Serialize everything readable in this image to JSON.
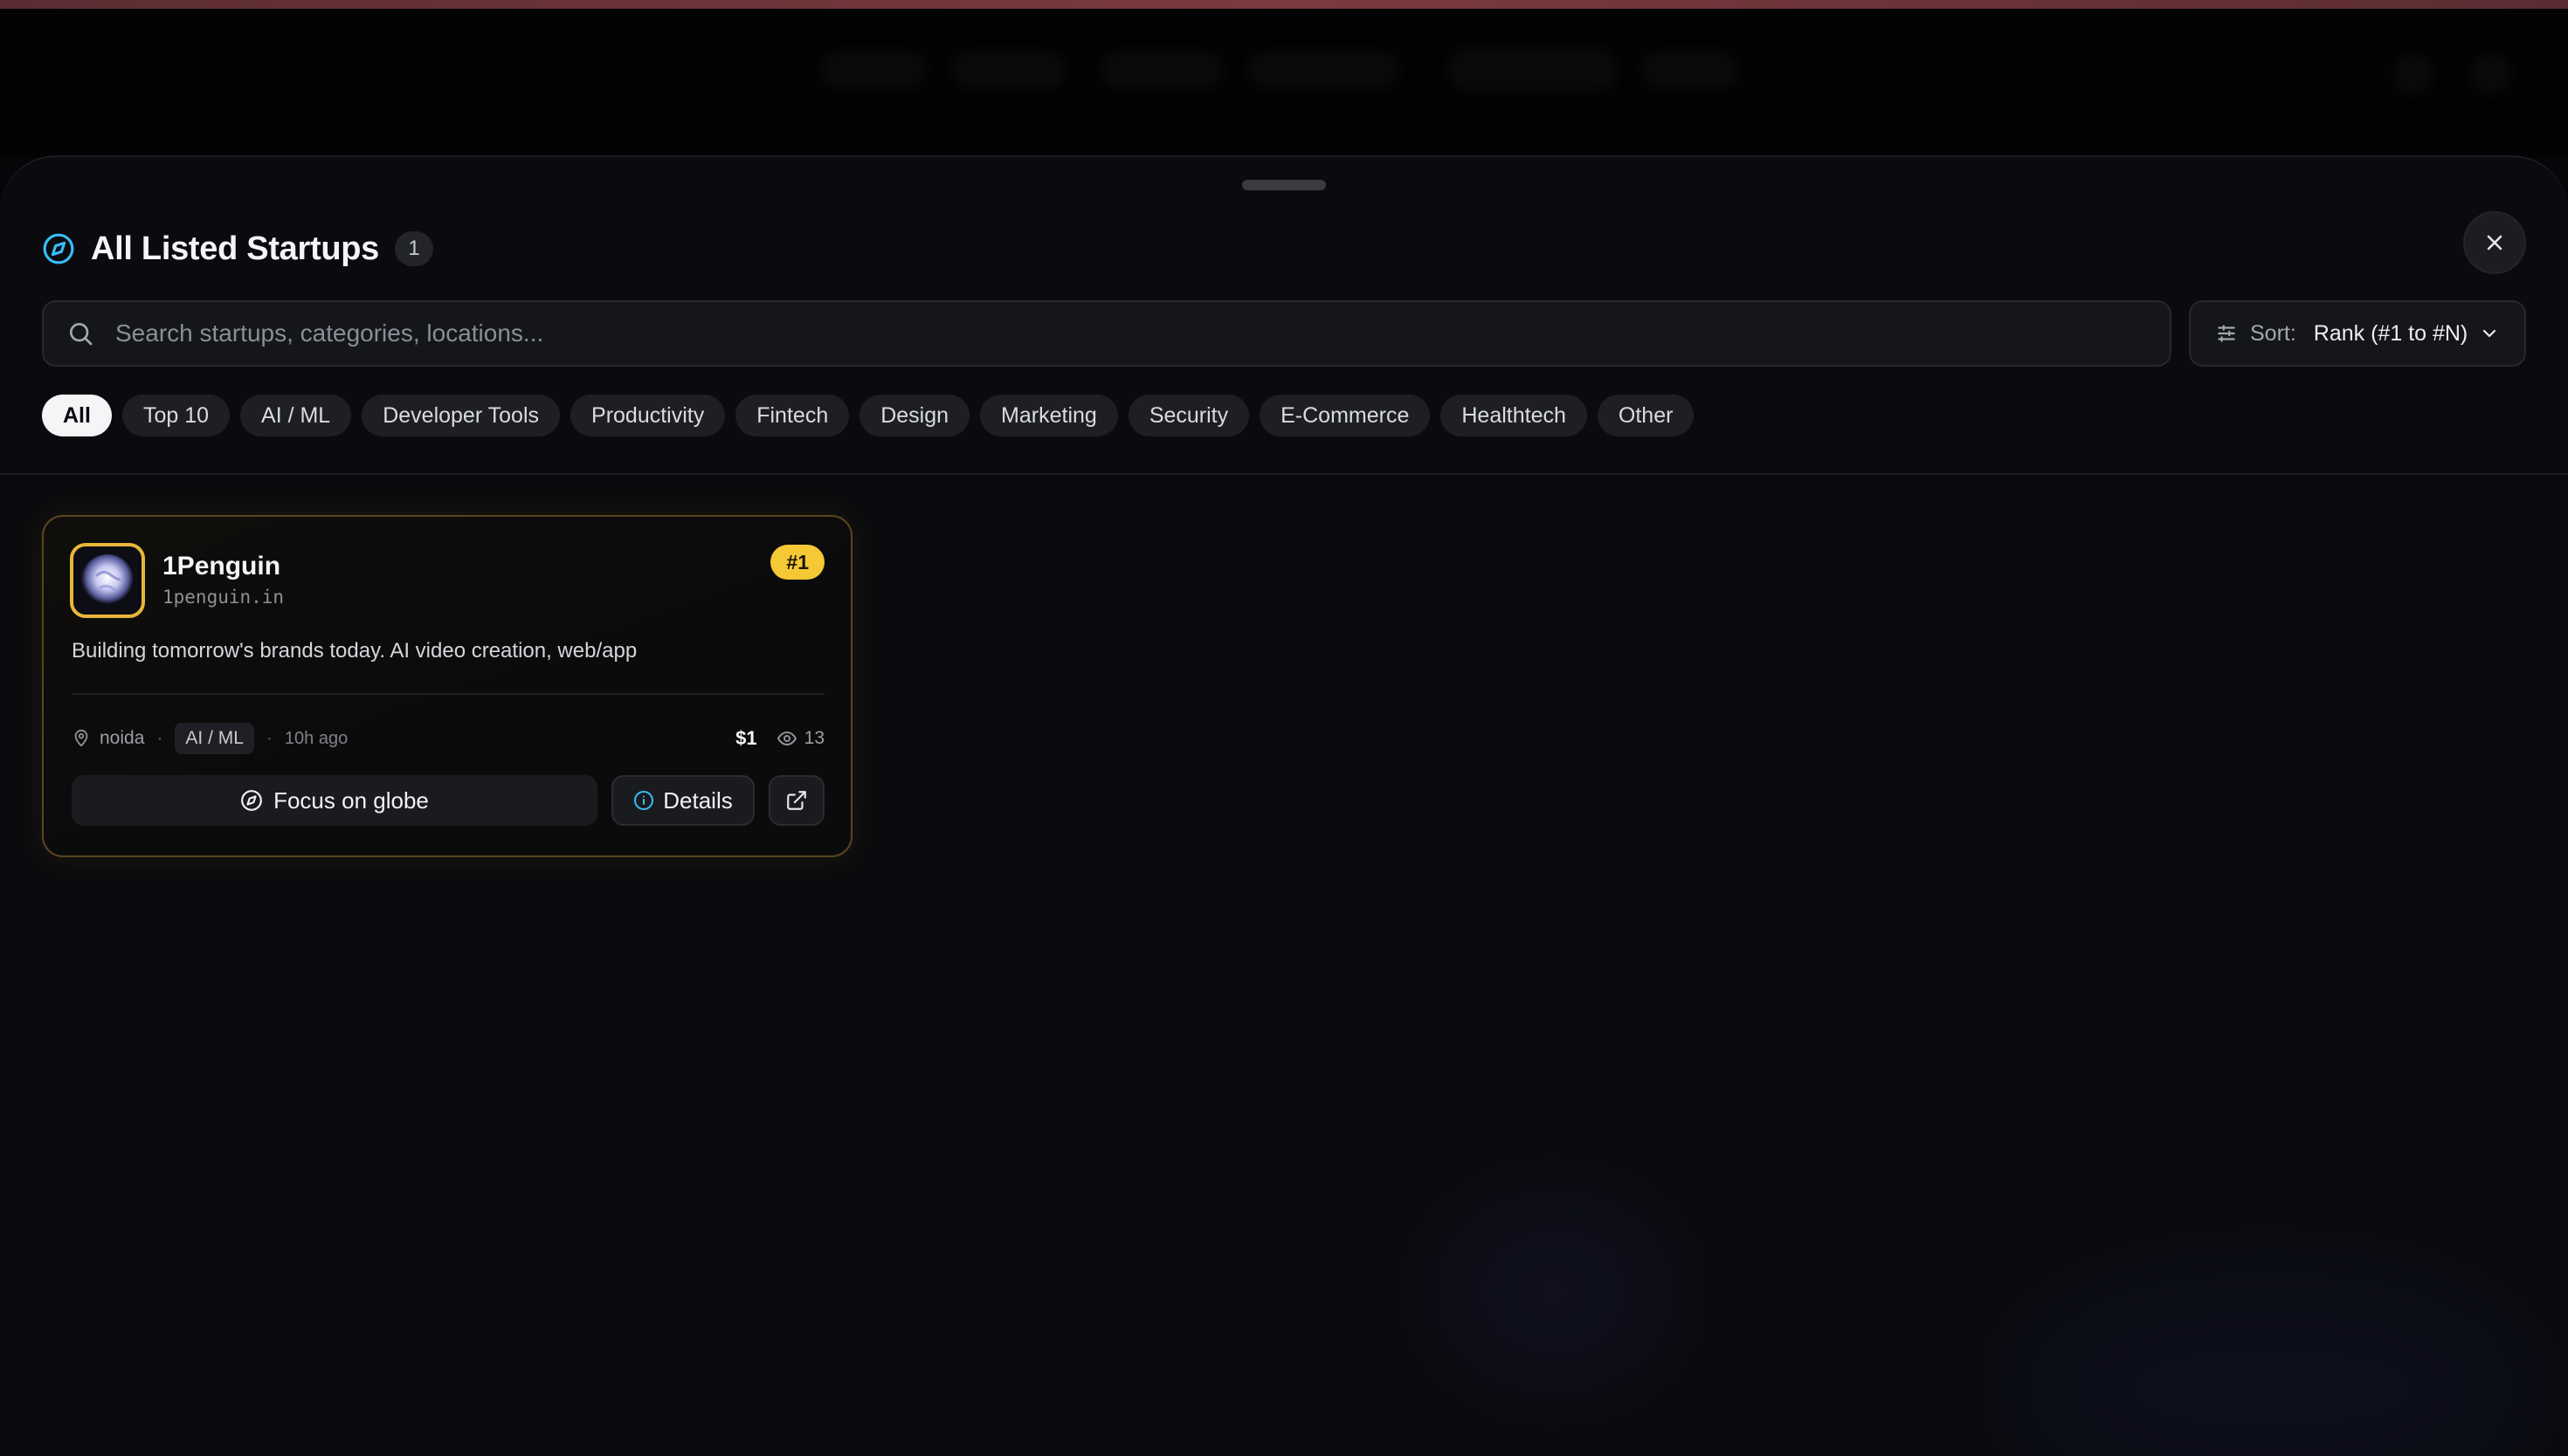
{
  "sheet": {
    "title": "All Listed Startups",
    "count": "1"
  },
  "search": {
    "placeholder": "Search startups, categories, locations..."
  },
  "sort": {
    "label": "Sort:",
    "value": "Rank (#1 to #N)"
  },
  "filters": [
    "All",
    "Top 10",
    "AI / ML",
    "Developer Tools",
    "Productivity",
    "Fintech",
    "Design",
    "Marketing",
    "Security",
    "E-Commerce",
    "Healthtech",
    "Other"
  ],
  "active_filter": "All",
  "startups": [
    {
      "name": "1Penguin",
      "domain": "1penguin.in",
      "rank": "#1",
      "description": "Building tomorrow's brands today. AI video creation, web/app",
      "location": "noida",
      "category": "AI / ML",
      "time": "10h ago",
      "price": "$1",
      "views": "13",
      "focus_label": "Focus on globe",
      "details_label": "Details"
    }
  ],
  "colors": {
    "accent_cyan": "#38bdf8",
    "rank_badge": "#f5c836",
    "card_border": "#5a4520"
  },
  "icons": [
    "compass-icon",
    "close-icon",
    "search-icon",
    "sliders-icon",
    "chevron-down-icon",
    "map-pin-icon",
    "eye-icon",
    "info-icon",
    "external-link-icon"
  ]
}
